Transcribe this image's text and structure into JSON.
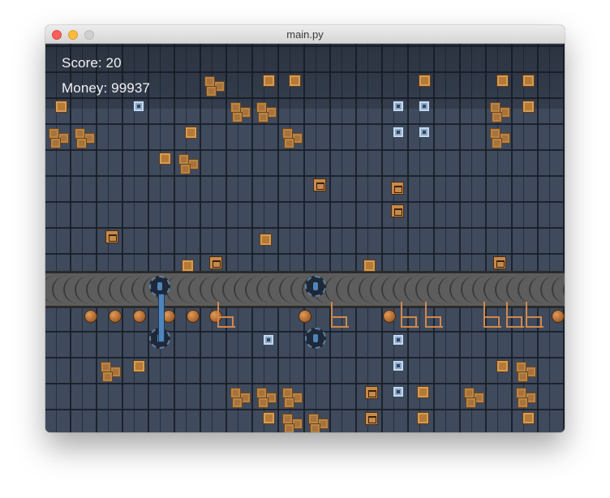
{
  "window": {
    "title": "main.py"
  },
  "hud": {
    "score_text": "Score: 20",
    "money_text": "Money: 99937"
  },
  "colors": {
    "floor": "#3f4a5c",
    "conveyor": "#5d5d5d",
    "hud_text": "#f2f2f2",
    "crate": "#a8733a",
    "vault": "#8ba7c5",
    "wheel": "#4e85bb"
  },
  "sprites": {
    "crate_stack": "stacked-crates-icon",
    "crate": "crate-icon",
    "vault": "vault-icon",
    "bear_crate": "bear-crate-icon",
    "ball": "ball-icon",
    "chair": "chair-icon",
    "turnstile": "turnstile-icon"
  }
}
